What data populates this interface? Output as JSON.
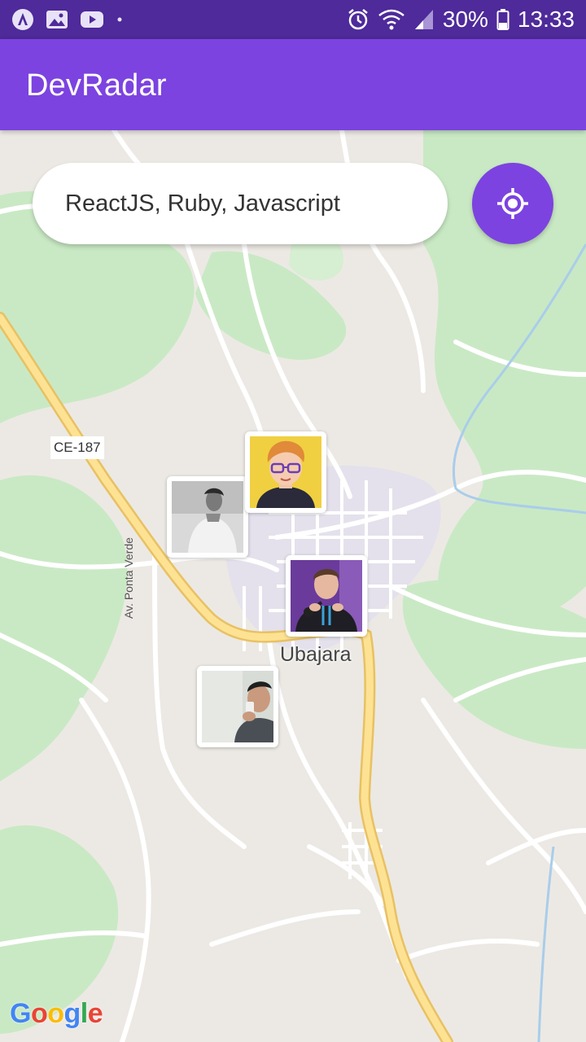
{
  "status_bar": {
    "battery": "30%",
    "time": "13:33",
    "left_icons": [
      "app-icon",
      "image-icon",
      "youtube-icon",
      "dot-icon"
    ],
    "right_icons": [
      "alarm-icon",
      "wifi-icon",
      "signal-icon",
      "battery-icon"
    ]
  },
  "app_bar": {
    "title": "DevRadar"
  },
  "search": {
    "value": "ReactJS, Ruby, Javascript"
  },
  "map": {
    "road_label": "CE-187",
    "street_label": "Av. Ponta Verde",
    "city_label": "Ubajara",
    "logo": [
      "G",
      "o",
      "o",
      "g",
      "l",
      "e"
    ],
    "logo_colors": [
      "#4285F4",
      "#EA4335",
      "#FBBC05",
      "#4285F4",
      "#34A853",
      "#EA4335"
    ]
  },
  "markers": [
    {
      "id": "dev-1",
      "description": "avatar cartoon"
    },
    {
      "id": "dev-2",
      "description": "photo black and white"
    },
    {
      "id": "dev-3",
      "description": "photo with microphone"
    },
    {
      "id": "dev-4",
      "description": "photo selfie"
    }
  ],
  "colors": {
    "status_bar": "#4e2a9a",
    "primary": "#7c43e0",
    "map_land": "#ece9e4",
    "map_green": "#c9e9c4",
    "road_major": "#f8d77a"
  }
}
